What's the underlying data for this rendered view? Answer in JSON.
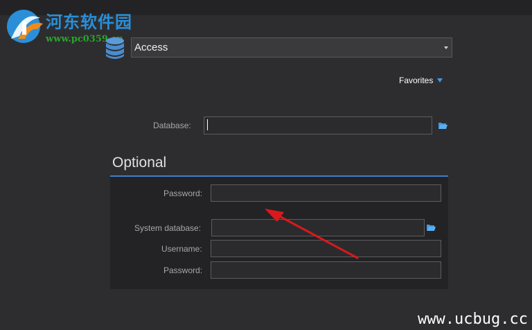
{
  "watermark": {
    "title": "河东软件园",
    "url": "www.pc0359.cn",
    "bottom": "www.ucbug.cc"
  },
  "provider": {
    "icon": "database-icon",
    "selected": "Access"
  },
  "favorites": {
    "label": "Favorites",
    "icon": "triangle-down-icon",
    "accent": "#3d9ae8"
  },
  "database_field": {
    "label": "Database:",
    "value": "",
    "browse_icon": "folder-open-icon"
  },
  "optional": {
    "title": "Optional",
    "accent": "#3f7fc4",
    "password1_label": "Password:",
    "system_db_label": "System database:",
    "username_label": "Username:",
    "password2_label": "Password:"
  },
  "annotation": {
    "color": "#d9191c"
  }
}
